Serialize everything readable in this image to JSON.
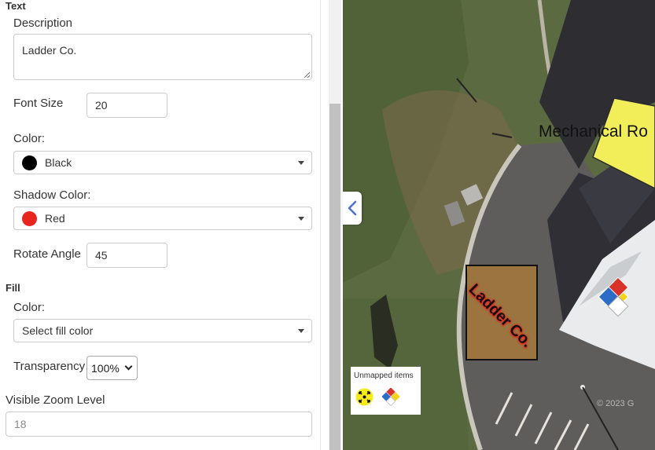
{
  "text_section": {
    "title": "Text",
    "description_label": "Description",
    "description_value": "Ladder Co.",
    "font_size_label": "Font Size",
    "font_size_value": "20",
    "color_label": "Color:",
    "color_value": "Black",
    "color_swatch": "#000000",
    "shadow_color_label": "Shadow Color:",
    "shadow_color_value": "Red",
    "shadow_swatch": "#e8251f",
    "rotate_label": "Rotate Angle",
    "rotate_value": "45"
  },
  "fill_section": {
    "title": "Fill",
    "color_label": "Color:",
    "color_placeholder": "Select fill color",
    "transparency_label": "Transparency",
    "transparency_value": "100%"
  },
  "zoom": {
    "label": "Visible Zoom Level",
    "placeholder": "18"
  },
  "map": {
    "room_label": "Mechanical Ro",
    "annotation_text": "Ladder Co.",
    "watermark": "© 2023 G",
    "unmapped_title": "Unmapped items",
    "unmapped_icons": [
      "assembly-point-icon",
      "hazmat-diamond-icon"
    ]
  }
}
